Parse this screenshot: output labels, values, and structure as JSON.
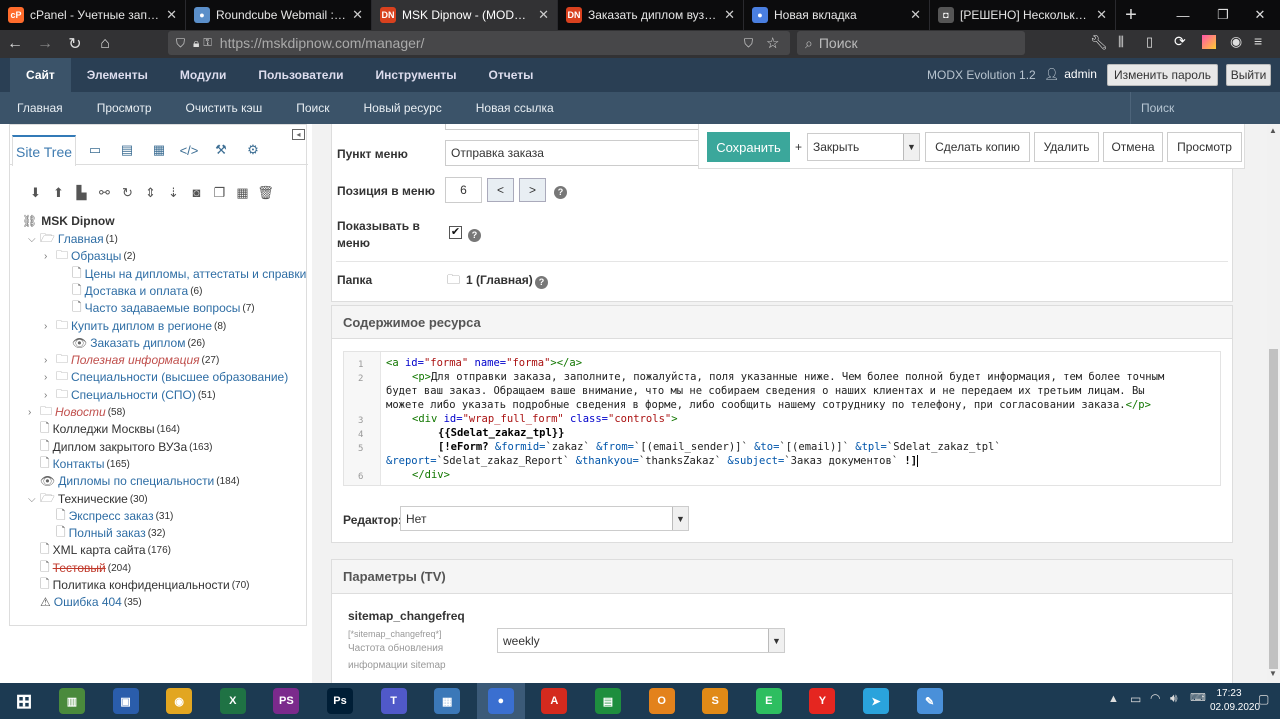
{
  "browser": {
    "tabs": [
      {
        "title": "cPanel - Учетные записи",
        "icon": "cpanel-icon",
        "color": "#ff6c2c",
        "glyph": "cP"
      },
      {
        "title": "Roundcube Webmail :: Вх",
        "icon": "roundcube-icon",
        "color": "#5b8fc9",
        "glyph": "●"
      },
      {
        "title": "MSK Dipnow - (MODX CM",
        "icon": "dn-icon",
        "color": "#d9411e",
        "glyph": "DN"
      },
      {
        "title": "Заказать диплом вуза, ко",
        "icon": "dn-icon",
        "color": "#d9411e",
        "glyph": "DN"
      },
      {
        "title": "Новая вкладка",
        "icon": "firefox-icon",
        "color": "#4a7fe0",
        "glyph": "●"
      },
      {
        "title": "[РЕШЕНО] Несколько ая",
        "icon": "forum-icon",
        "color": "#555",
        "glyph": "◘"
      }
    ],
    "url_host": "https://mskdipnow.com",
    "url_path": "/manager/",
    "search_placeholder": "Поиск"
  },
  "header": {
    "main_menu": [
      "Сайт",
      "Элементы",
      "Модули",
      "Пользователи",
      "Инструменты",
      "Отчеты"
    ],
    "version": "MODX Evolution 1.2",
    "user": "admin",
    "change_password": "Изменить пароль",
    "logout": "Выйти",
    "sub_menu": [
      "Главная",
      "Просмотр",
      "Очистить кэш",
      "Поиск",
      "Новый ресурс",
      "Новая ссылка"
    ],
    "search_placeholder": "Поиск"
  },
  "sidebar": {
    "tab_site_tree": "Site Tree",
    "root": "MSK Dipnow",
    "tree": [
      {
        "label": "Главная",
        "count": "(1)",
        "level": 1,
        "type": "folder-open",
        "style": "link",
        "caret": "down"
      },
      {
        "label": "Образцы",
        "count": "(2)",
        "level": 2,
        "type": "folder",
        "style": "link",
        "caret": "right"
      },
      {
        "label": "Цены на дипломы, аттестаты и справки",
        "count": "",
        "level": 3,
        "type": "doc",
        "style": "link",
        "caret": ""
      },
      {
        "label": "Доставка и оплата",
        "count": "(6)",
        "level": 3,
        "type": "doc",
        "style": "link",
        "caret": ""
      },
      {
        "label": "Часто задаваемые вопросы",
        "count": "(7)",
        "level": 3,
        "type": "doc",
        "style": "link",
        "caret": ""
      },
      {
        "label": "Купить диплом в регионе",
        "count": "(8)",
        "level": 2,
        "type": "folder",
        "style": "link",
        "caret": "right"
      },
      {
        "label": "Заказать диплом",
        "count": "(26)",
        "level": 3,
        "type": "eye",
        "style": "link",
        "caret": ""
      },
      {
        "label": "Полезная информация",
        "count": "(27)",
        "level": 2,
        "type": "folder",
        "style": "italic",
        "caret": "right"
      },
      {
        "label": "Специальности (высшее образование)",
        "count": "",
        "level": 2,
        "type": "folder",
        "style": "link",
        "caret": "right"
      },
      {
        "label": "Специальности (СПО)",
        "count": "(51)",
        "level": 2,
        "type": "folder",
        "style": "link",
        "caret": "right"
      },
      {
        "label": "Новости",
        "count": "(58)",
        "level": 1,
        "type": "folder",
        "style": "italic",
        "caret": "right"
      },
      {
        "label": "Колледжи Москвы",
        "count": "(164)",
        "level": 1,
        "type": "doc",
        "style": "plain",
        "caret": ""
      },
      {
        "label": "Диплом закрытого ВУЗа",
        "count": "(163)",
        "level": 1,
        "type": "doc",
        "style": "plain",
        "caret": ""
      },
      {
        "label": "Контакты",
        "count": "(165)",
        "level": 1,
        "type": "doc",
        "style": "link",
        "caret": ""
      },
      {
        "label": "Дипломы по специальности",
        "count": "(184)",
        "level": 1,
        "type": "eye",
        "style": "link",
        "caret": ""
      },
      {
        "label": "Технические",
        "count": "(30)",
        "level": 1,
        "type": "folder-open",
        "style": "plain",
        "caret": "down"
      },
      {
        "label": "Экспресс заказ",
        "count": "(31)",
        "level": 2,
        "type": "doc",
        "style": "link",
        "caret": ""
      },
      {
        "label": "Полный заказ",
        "count": "(32)",
        "level": 2,
        "type": "doc",
        "style": "link",
        "caret": ""
      },
      {
        "label": "XML карта сайта",
        "count": "(176)",
        "level": 1,
        "type": "doc",
        "style": "plain",
        "caret": ""
      },
      {
        "label": "Тестовый",
        "count": "(204)",
        "level": 1,
        "type": "doc",
        "style": "strike",
        "caret": ""
      },
      {
        "label": "Политика конфиденциальности",
        "count": "(70)",
        "level": 1,
        "type": "doc",
        "style": "plain",
        "caret": ""
      },
      {
        "label": "Ошибка 404",
        "count": "(35)",
        "level": 1,
        "type": "warn",
        "style": "link",
        "caret": ""
      }
    ]
  },
  "form": {
    "menu_item_label": "Пункт меню",
    "menu_item_value": "Отправка заказа",
    "menu_pos_label": "Позиция в меню",
    "menu_pos_value": "6",
    "prev": "<",
    "next": ">",
    "show_in_menu_label1": "Показывать в",
    "show_in_menu_label2": "меню",
    "folder_label": "Папка",
    "folder_value": "1 (Главная)",
    "content_header": "Содержимое ресурса",
    "editor_label": "Редактор:",
    "editor_value": "Нет",
    "tv_header": "Параметры (TV)",
    "tv_name": "sitemap_changefreq",
    "tv_tag": "[*sitemap_changefreq*]",
    "tv_desc1": "Частота обновления",
    "tv_desc2": "информации sitemap",
    "tv_value": "weekly"
  },
  "toolbar": {
    "save": "Сохранить",
    "plus": "+",
    "close_select": "Закрыть",
    "copy": "Сделать копию",
    "delete": "Удалить",
    "cancel": "Отмена",
    "preview": "Просмотр"
  },
  "code": {
    "line_numbers": [
      "1",
      "2",
      "",
      "",
      "3",
      "4",
      "5",
      "",
      "6"
    ],
    "line1_tag_open": "<a ",
    "line1_attr1": "id=",
    "line1_val1": "\"forma\"",
    "line1_attr2": " name=",
    "line1_val2": "\"forma\"",
    "line1_tag_close": "></a>",
    "line2a_tag": "<p>",
    "line2a_text": "Для отправки заказа, заполните, пожалуйста, поля указанные ниже. Чем более полной будет информация, тем более точным",
    "line2b_text": "будет ваш заказ. Обращаем ваше внимание, что мы не собираем сведения о наших клиентах и не передаем их третьим лицам. Вы",
    "line2c_text": "можете либо указать подробные сведения в форме, либо сообщить нашему сотруднику по телефону, при согласовании заказа.",
    "line2c_tag": "</p>",
    "line3_tag_open": "<div ",
    "line3_attr1": "id=",
    "line3_val1": "\"wrap_full_form\"",
    "line3_attr2": " class=",
    "line3_val2": "\"controls\"",
    "line3_tag_close": ">",
    "line4": "{{Sdelat_zakaz_tpl}}",
    "line5a_start": "[!eForm? ",
    "line5a_p1": "&formid=",
    "line5a_v1": "`zakaz` ",
    "line5a_p2": "&from=",
    "line5a_v2": "`[(email_sender)]` ",
    "line5a_p3": "&to=",
    "line5a_v3": "`[(email)]` ",
    "line5a_p4": "&tpl=",
    "line5a_v4": "`Sdelat_zakaz_tpl`",
    "line5b_p1": "&report=",
    "line5b_v1": "`Sdelat_zakaz_Report`  ",
    "line5b_p2": "&thankyou=",
    "line5b_v2": "`thanksZakaz`  ",
    "line5b_p3": "&subject=",
    "line5b_v3": "`Заказ документов` ",
    "line5b_end": "!]",
    "line6": "</div>"
  },
  "taskbar": {
    "apps": [
      {
        "name": "windows-start-icon",
        "color": "#1c3a52",
        "glyph": "⊞"
      },
      {
        "name": "taskmanager-icon",
        "color": "#4a8a3c",
        "glyph": "▥"
      },
      {
        "name": "save-disk-icon",
        "color": "#2a5dab",
        "glyph": "▣"
      },
      {
        "name": "chrome-icon",
        "color": "#e2a621",
        "glyph": "◉"
      },
      {
        "name": "excel-icon",
        "color": "#1f7244",
        "glyph": "X"
      },
      {
        "name": "phpstorm-icon",
        "color": "#7b2a8c",
        "glyph": "PS"
      },
      {
        "name": "photoshop-icon",
        "color": "#001e36",
        "glyph": "Ps"
      },
      {
        "name": "teams-icon",
        "color": "#5059c9",
        "glyph": "T"
      },
      {
        "name": "remote-icon",
        "color": "#3b78b8",
        "glyph": "▦"
      },
      {
        "name": "firefox-icon",
        "color": "#3a6fd0",
        "glyph": "●"
      },
      {
        "name": "pdf-icon",
        "color": "#d42a1e",
        "glyph": "A"
      },
      {
        "name": "project-icon",
        "color": "#1e8e3e",
        "glyph": "▤"
      },
      {
        "name": "outlook-icon",
        "color": "#e3821c",
        "glyph": "O"
      },
      {
        "name": "sublime-icon",
        "color": "#e08a17",
        "glyph": "S"
      },
      {
        "name": "evernote-icon",
        "color": "#2dbe60",
        "glyph": "E"
      },
      {
        "name": "yandex-icon",
        "color": "#e52620",
        "glyph": "Y"
      },
      {
        "name": "telegram-icon",
        "color": "#2aa3dc",
        "glyph": "➤"
      },
      {
        "name": "paint-icon",
        "color": "#4a90d9",
        "glyph": "✎"
      }
    ],
    "time": "17:23",
    "date": "02.09.2020"
  }
}
